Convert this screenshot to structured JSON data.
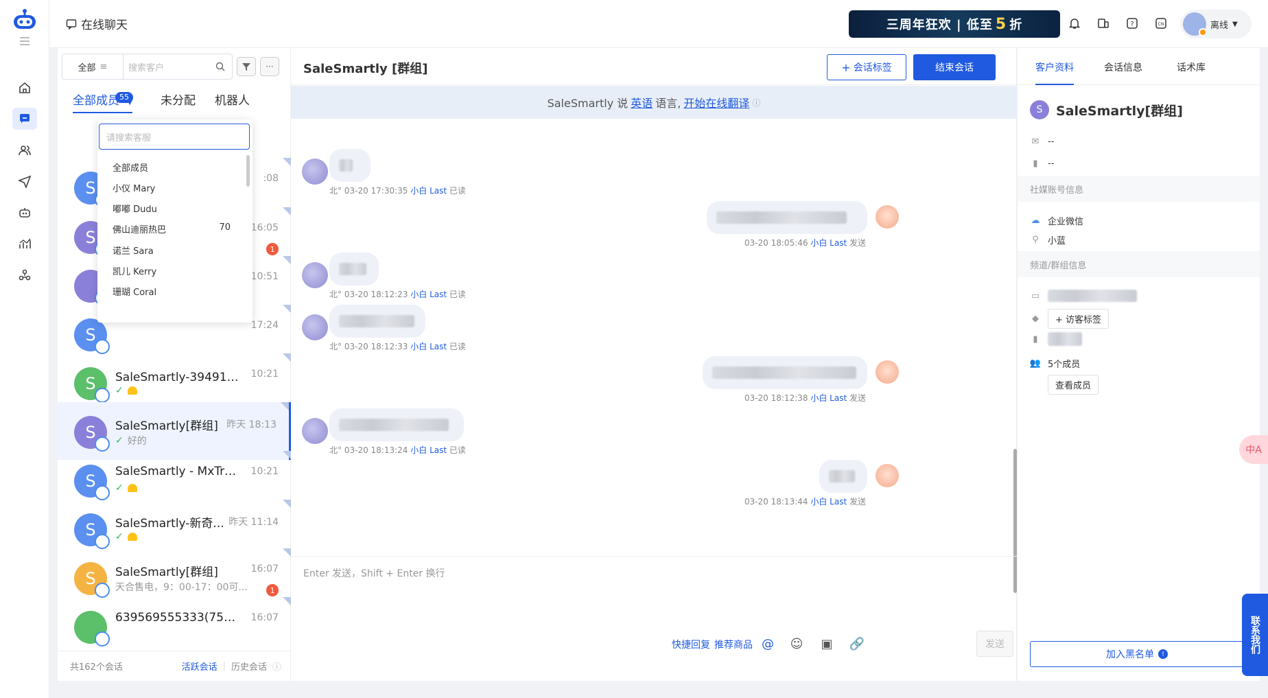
{
  "header": {
    "page_title": "在线聊天",
    "banner_text_before": "三周年狂欢 | 低至",
    "banner_five": "5",
    "banner_text_after": "折",
    "user_status": "离线"
  },
  "list": {
    "filter_select": "全部",
    "search_placeholder": "搜索客户",
    "tabs": [
      {
        "label": "全部成员"
      },
      {
        "label": "未分配"
      },
      {
        "label": "机器人"
      }
    ],
    "all_members_count": "55",
    "conversations": [
      {
        "avatar_letter": "S",
        "name": "",
        "time": ":08",
        "preview": "",
        "avatar_color": "#5b8ff0"
      },
      {
        "avatar_letter": "S",
        "name": "",
        "time": "16:05",
        "preview": "",
        "badge": "1",
        "avatar_color": "#8b80d9"
      },
      {
        "avatar_letter": "",
        "name": "",
        "time": "10:51",
        "preview": "",
        "avatar_color": "#8b80d9"
      },
      {
        "avatar_letter": "S",
        "name": "",
        "time": "17:24",
        "preview": "",
        "avatar_color": "#5b8ff0"
      },
      {
        "avatar_letter": "S",
        "name": "SaleSmartly-39491[群...",
        "time": "10:21",
        "preview": "",
        "avatar_color": "#5cbf6a"
      },
      {
        "avatar_letter": "S",
        "name": "SaleSmartly[群组]",
        "time": "昨天 18:13",
        "preview": "好的",
        "avatar_color": "#8b80d9"
      },
      {
        "avatar_letter": "S",
        "name": "SaleSmartly - MxTradi...",
        "time": "10:21",
        "preview": "",
        "avatar_color": "#5b8ff0"
      },
      {
        "avatar_letter": "S",
        "name": "SaleSmartly-新奇...",
        "time": "昨天 11:14",
        "preview": "",
        "avatar_color": "#5b8ff0"
      },
      {
        "avatar_letter": "S",
        "name": "SaleSmartly[群组]",
        "time": "16:07",
        "preview": "天合售电，9：00-17：00可...",
        "badge": "1",
        "avatar_color": "#f5b342"
      },
      {
        "avatar_letter": "",
        "name": "639569555333(759...",
        "time": "16:07",
        "preview": "",
        "avatar_color": "#5cbf6a"
      }
    ],
    "footer_total": "共162个会话",
    "footer_active": "活跃会话",
    "footer_history": "历史会话"
  },
  "dropdown": {
    "search_placeholder": "请搜索客服",
    "items": [
      {
        "label": "全部成员",
        "count": ""
      },
      {
        "label": "小仪 Mary",
        "count": ""
      },
      {
        "label": "嘟嘟 Dudu",
        "count": ""
      },
      {
        "label": "佛山迪丽热巴",
        "count": "70"
      },
      {
        "label": "诺兰 Sara",
        "count": ""
      },
      {
        "label": "凯儿 Kerry",
        "count": ""
      },
      {
        "label": "珊瑚 Coral",
        "count": ""
      }
    ]
  },
  "chat": {
    "title": "SaleSmartly [群组]",
    "tag_button": "会话标签",
    "end_button": "结束会话",
    "translate_bar": {
      "prefix": "SaleSmartly 说",
      "lang": "英语",
      "mid": "语言,",
      "link": "开始在线翻译"
    },
    "messages": [
      {
        "side": "in",
        "prefix": "北°",
        "time": "03-20 17:30:35",
        "who": "小白 Last",
        "status": "已读"
      },
      {
        "side": "out",
        "time": "03-20 18:05:46",
        "who": "小白 Last",
        "status": "发送"
      },
      {
        "side": "in",
        "prefix": "北°",
        "time": "03-20 18:12:23",
        "who": "小白 Last",
        "status": "已读"
      },
      {
        "side": "in",
        "prefix": "北°",
        "time": "03-20 18:12:33",
        "who": "小白 Last",
        "status": "已读"
      },
      {
        "side": "out",
        "time": "03-20 18:12:38",
        "who": "小白 Last",
        "status": "发送"
      },
      {
        "side": "in",
        "prefix": "北°",
        "time": "03-20 18:13:24",
        "who": "小白 Last",
        "status": "已读"
      },
      {
        "side": "out",
        "time": "03-20 18:13:44",
        "who": "小白 Last",
        "status": "发送"
      }
    ],
    "input_placeholder": "Enter 发送，Shift + Enter 换行",
    "quick_reply": "快捷回复",
    "recommend": "推荐商品",
    "send": "发送"
  },
  "right": {
    "tabs": [
      {
        "label": "客户资料"
      },
      {
        "label": "会话信息"
      },
      {
        "label": "话术库"
      }
    ],
    "avatar_letter": "S",
    "customer_name": "SaleSmartly[群组]",
    "email": "--",
    "phone": "--",
    "social_header": "社媒账号信息",
    "social_channel": "企业微信",
    "social_account": "小蓝",
    "channel_header": "频道/群组信息",
    "visitor_tag": "访客标签",
    "members": "5个成员",
    "view_members": "查看成员",
    "blacklist": "加入黑名单",
    "info_mark": "!"
  },
  "floats": {
    "contact_us": "联系我们",
    "translate": "中A"
  },
  "colors": {
    "primary": "#1f5ae0",
    "badge_red": "#f05a3c",
    "check_green": "#2bbd5a"
  }
}
